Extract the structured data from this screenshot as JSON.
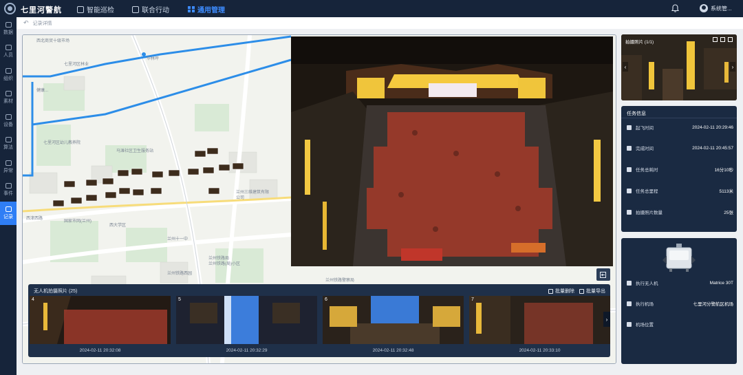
{
  "app": {
    "title": "七里河警航"
  },
  "nav": {
    "tabs": [
      {
        "label": "智能巡检",
        "active": false
      },
      {
        "label": "联合行动",
        "active": false
      },
      {
        "label": "通用管理",
        "active": true
      }
    ]
  },
  "user": {
    "name": "系统管..."
  },
  "sidebar": {
    "items": [
      {
        "label": "数据",
        "active": false
      },
      {
        "label": "人员",
        "active": false
      },
      {
        "label": "组织",
        "active": false
      },
      {
        "label": "素材",
        "active": false
      },
      {
        "label": "设备",
        "active": false
      },
      {
        "label": "算法",
        "active": false
      },
      {
        "label": "异常",
        "active": false
      },
      {
        "label": "事件",
        "active": false
      },
      {
        "label": "记录",
        "active": true
      }
    ]
  },
  "breadcrumb": {
    "back": "↶",
    "current": "记录详情"
  },
  "map": {
    "labels": [
      "西北商贸十级市场",
      "华林坪",
      "七里河区林业",
      "健康...",
      "七里河区幼儿教养院",
      "马滩社区卫生服务站",
      "兰州三维建筑有限",
      "公司",
      "西津西路",
      "国家市网(兰州)",
      "西大学区",
      "兰州十一中",
      "兰州铁路局",
      "兰州铁路(局)小区",
      "兰州铁路西园",
      "兰州铁路警察局"
    ]
  },
  "gallery": {
    "title": "无人机拍摄照片 (25)",
    "batch_delete": "批量删除",
    "batch_export": "批量导出",
    "items": [
      {
        "num": "4",
        "time": "2024-02-11 20:32:08"
      },
      {
        "num": "5",
        "time": "2024-02-11 20:32:29"
      },
      {
        "num": "6",
        "time": "2024-02-11 20:32:48"
      },
      {
        "num": "7",
        "time": "2024-02-11 20:33:10"
      }
    ]
  },
  "photo_card": {
    "label": "拍摄照片 (1/1)"
  },
  "task": {
    "title": "任务信息",
    "rows": [
      {
        "key": "起飞时间",
        "value": "2024-02-11 20:29:46",
        "icon": "takeoff-icon"
      },
      {
        "key": "完成时间",
        "value": "2024-02-11 20:45:57",
        "icon": "landing-icon"
      },
      {
        "key": "任务总耗时",
        "value": "16分10秒",
        "icon": "clock-icon"
      },
      {
        "key": "任务总里程",
        "value": "5113米",
        "icon": "distance-icon"
      },
      {
        "key": "拍摄照片数量",
        "value": "25张",
        "icon": "photo-icon"
      }
    ]
  },
  "device": {
    "rows": [
      {
        "key": "执行无人机",
        "value": "Matrice 30T",
        "icon": "drone-icon"
      },
      {
        "key": "执行机场",
        "value": "七里河分警航区机场",
        "icon": "dock-icon"
      },
      {
        "key": "机场位置",
        "value": "",
        "icon": "location-icon"
      }
    ]
  },
  "colors": {
    "topbar": "#16243a",
    "accent": "#2f7ef5",
    "panel": "#1a2a42",
    "route": "#2c8de8"
  }
}
